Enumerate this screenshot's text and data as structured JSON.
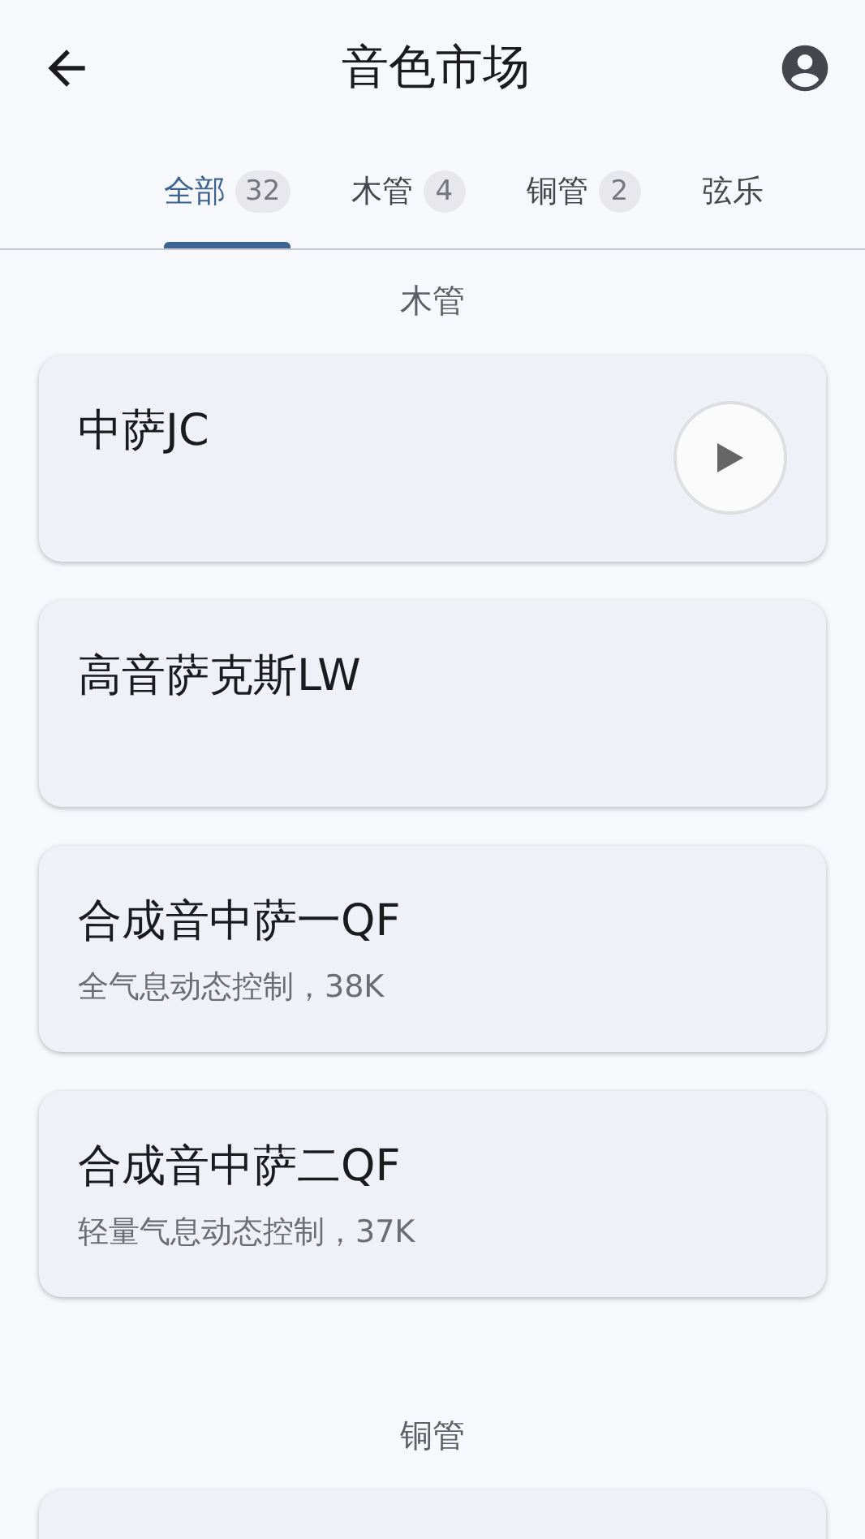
{
  "app_bar": {
    "title": "音色市场"
  },
  "tabs": [
    {
      "label": "全部",
      "count": "32",
      "selected": true
    },
    {
      "label": "木管",
      "count": "4",
      "selected": false
    },
    {
      "label": "铜管",
      "count": "2",
      "selected": false
    },
    {
      "label": "弦乐",
      "selected": false
    }
  ],
  "sections": [
    {
      "title": "木管",
      "items": [
        {
          "name": "中萨JC",
          "playable": true
        },
        {
          "name": "高音萨克斯LW",
          "playable": false
        },
        {
          "name": "合成音中萨一QF",
          "description": "全气息动态控制，38K",
          "playable": false
        },
        {
          "name": "合成音中萨二QF",
          "description": "轻量气息动态控制，37K",
          "playable": false
        }
      ]
    },
    {
      "title": "铜管",
      "items": [
        {
          "playable": false
        }
      ]
    }
  ]
}
